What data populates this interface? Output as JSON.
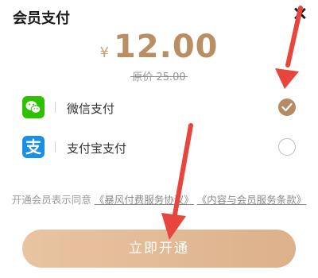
{
  "header": {
    "title": "会员支付",
    "close_icon": "close-icon"
  },
  "price": {
    "currency": "¥",
    "amount": "12.00",
    "original": "原价 25.00"
  },
  "payment_methods": [
    {
      "label": "微信支付",
      "icon": "wechat-icon",
      "selected": true
    },
    {
      "label": "支付宝支付",
      "icon": "alipay-icon",
      "selected": false
    }
  ],
  "agreement": {
    "prefix": "开通会员表示同意",
    "link1": "《暴风付费服务协议》",
    "link2": "《内容与会员服务条款》"
  },
  "cta": {
    "label": "立即开通"
  },
  "colors": {
    "accent": "#b98e62",
    "wechat": "#2dc100",
    "alipay": "#1a8fe6",
    "annotation": "#e8453c"
  }
}
